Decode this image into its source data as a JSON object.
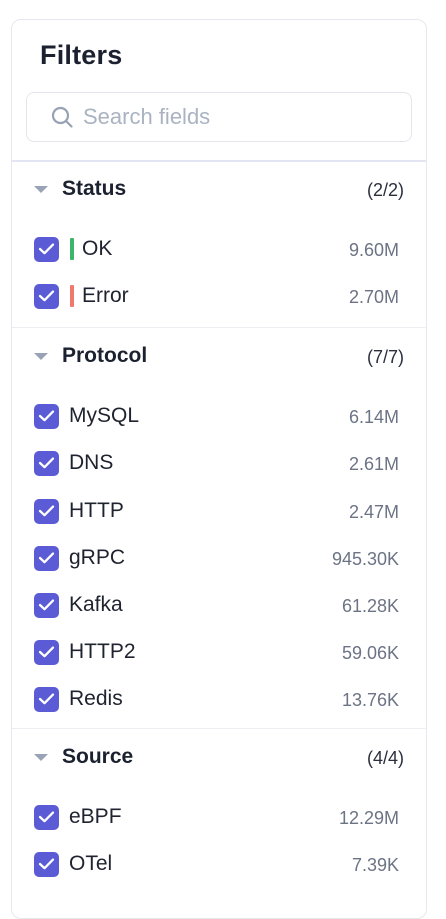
{
  "panel": {
    "title": "Filters",
    "search": {
      "placeholder": "Search fields",
      "value": ""
    }
  },
  "colors": {
    "accent": "#5b5bd6",
    "ok": "#3fb56b",
    "error": "#ee7a6e"
  },
  "sections": {
    "status": {
      "title": "Status",
      "count": "(2/2)",
      "items": [
        {
          "label": "OK",
          "value": "9.60M",
          "checked": true,
          "status_color": "#3fb56b"
        },
        {
          "label": "Error",
          "value": "2.70M",
          "checked": true,
          "status_color": "#ee7a6e"
        }
      ]
    },
    "protocol": {
      "title": "Protocol",
      "count": "(7/7)",
      "items": [
        {
          "label": "MySQL",
          "value": "6.14M",
          "checked": true
        },
        {
          "label": "DNS",
          "value": "2.61M",
          "checked": true
        },
        {
          "label": "HTTP",
          "value": "2.47M",
          "checked": true
        },
        {
          "label": "gRPC",
          "value": "945.30K",
          "checked": true
        },
        {
          "label": "Kafka",
          "value": "61.28K",
          "checked": true
        },
        {
          "label": "HTTP2",
          "value": "59.06K",
          "checked": true
        },
        {
          "label": "Redis",
          "value": "13.76K",
          "checked": true
        }
      ]
    },
    "source": {
      "title": "Source",
      "count": "(4/4)",
      "items": [
        {
          "label": "eBPF",
          "value": "12.29M",
          "checked": true
        },
        {
          "label": "OTel",
          "value": "7.39K",
          "checked": true
        }
      ]
    }
  }
}
